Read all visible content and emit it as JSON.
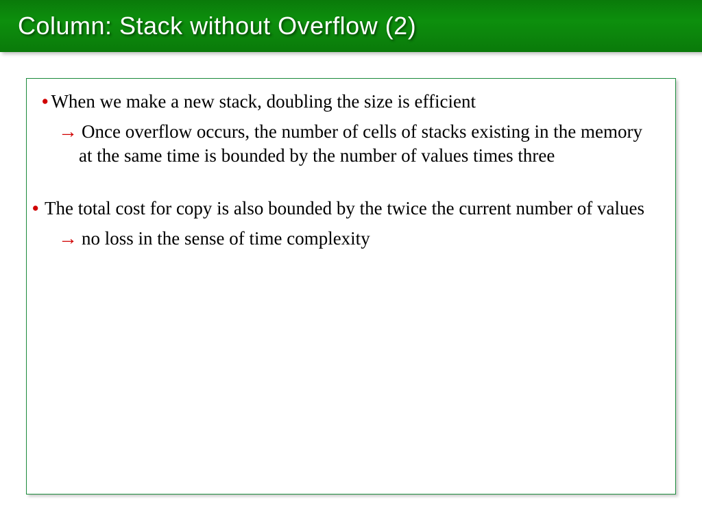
{
  "title": "Column: Stack without Overflow (2)",
  "items": [
    {
      "bullet_text": "When we make a new stack, doubling the size is efficient",
      "arrow_text": "Once overflow occurs, the number of cells of stacks existing in the memory at the same time is bounded by the number of values times three"
    },
    {
      "bullet_text": "The total cost for copy is also bounded by the twice the current number of values",
      "arrow_text": "no loss in the sense of time complexity"
    }
  ]
}
